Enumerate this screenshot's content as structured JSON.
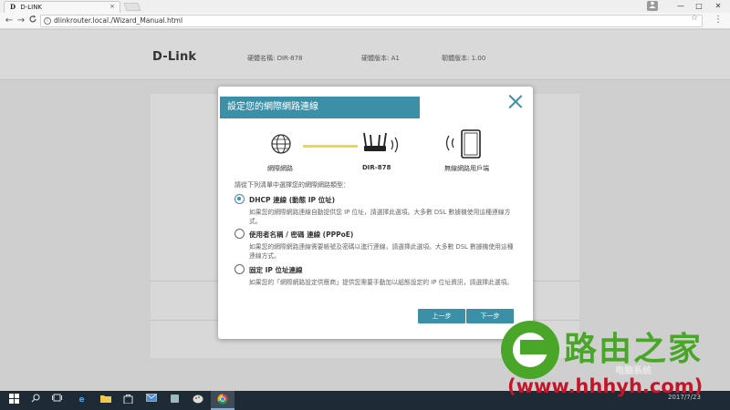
{
  "browser": {
    "tab_logo": "D",
    "tab_title": "D-LINK",
    "tab_close": "×",
    "url": "dlinkrouter.local./Wizard_Manual.html",
    "back": "←",
    "forward": "→",
    "reload": "C",
    "star": "☆",
    "menu": "⋮",
    "minimize": "—",
    "maximize": "□",
    "close": "✕",
    "user": "👤"
  },
  "header": {
    "logo": "D-Link",
    "model_label": "硬體名稱: DIR-878",
    "hw_version": "硬體版本: A1",
    "fw_version": "韌體版本: 1.00"
  },
  "modal": {
    "title": "設定您的網際網路連線",
    "diagram": {
      "internet_label": "網際網路",
      "router_label": "DIR-878",
      "client_label": "無線網路用戶端"
    },
    "prompt": "請從下列清單中選擇您的網際網路類型：",
    "options": [
      {
        "title": "DHCP 連線 (動態 IP 位址)",
        "desc": "如果您的網際網路連線自動提供您 IP 位址，請選擇此選項。大多數 DSL 數據機使用這種連線方式。",
        "checked": true
      },
      {
        "title": "使用者名稱 / 密碼 連線 (PPPoE)",
        "desc": "如果您的網際網路連線需要帳號及密碼以進行連線，請選擇此選項。大多數 DSL 數據機使用這種連線方式。",
        "checked": false
      },
      {
        "title": "固定 IP 位址連線",
        "desc": "如果您的「網際網路設定供應商」提供您需要手動加以組態設定的 IP 位址資訊，請選擇此選項。",
        "checked": false
      }
    ],
    "prev_button": "上一步",
    "next_button": "下一步"
  },
  "watermark": {
    "brand": "路由之家",
    "url": "(www.hhhyh.com)",
    "small": "电脑系统"
  },
  "taskbar": {
    "clock": "2017/7/23"
  },
  "colors": {
    "accent": "#3b90a8",
    "link_line": "#ecd94a",
    "watermark_green": "#4aa628",
    "watermark_red": "#c4162a"
  }
}
